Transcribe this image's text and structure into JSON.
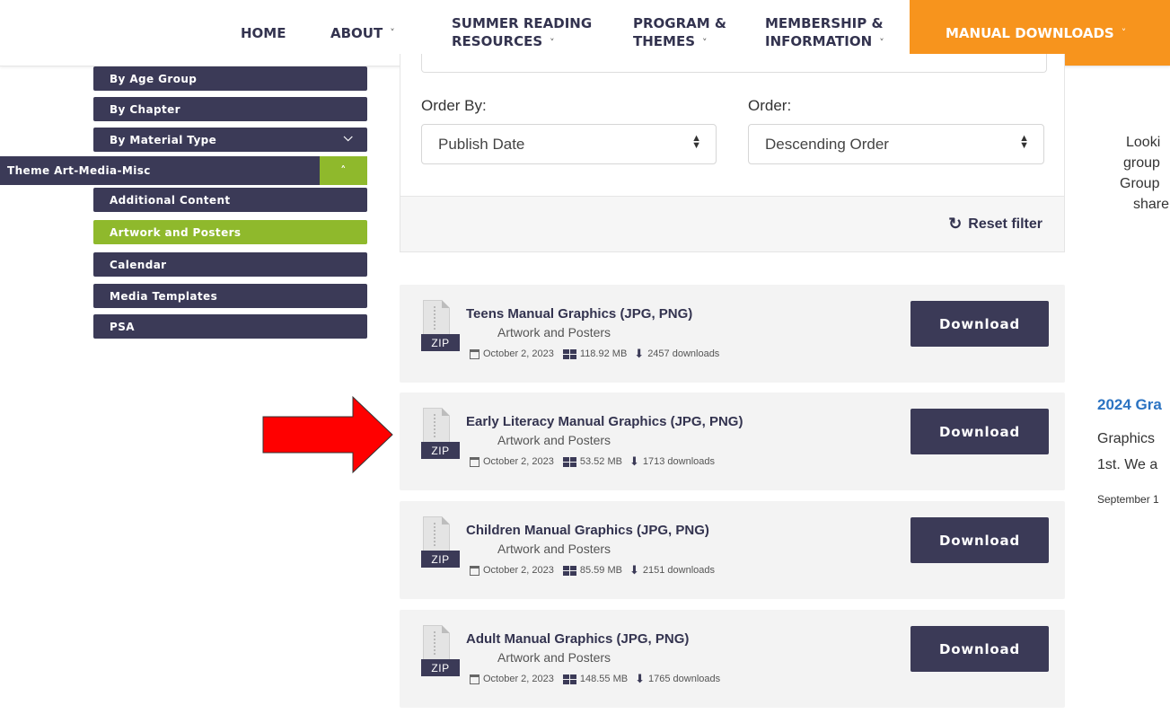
{
  "nav": {
    "items": [
      {
        "line1": "HOME",
        "line2": "",
        "chevron": false
      },
      {
        "line1": "ABOUT",
        "line2": "",
        "chevron": true
      },
      {
        "line1": "SUMMER READING",
        "line2": "RESOURCES",
        "chevron": true
      },
      {
        "line1": "PROGRAM &",
        "line2": "THEMES",
        "chevron": true
      },
      {
        "line1": "MEMBERSHIP &",
        "line2": "INFORMATION",
        "chevron": true
      }
    ],
    "active_label": "MANUAL DOWNLOADS",
    "chevron_glyph": "˅",
    "accent_color": "#f7941d"
  },
  "sidebar": {
    "top_items": [
      "By Age Group",
      "By Chapter",
      "By Material Type"
    ],
    "parent": "Theme Art-Media-Misc",
    "sub_items": [
      "Additional Content",
      "Artwork and Posters",
      "Calendar",
      "Media Templates",
      "PSA"
    ],
    "active_item": "Artwork and Posters",
    "colors": {
      "dark": "#3b3a57",
      "active": "#8fb92c"
    }
  },
  "filter": {
    "order_by_label": "Order By:",
    "order_by_value": "Publish Date",
    "order_label": "Order:",
    "order_value": "Descending Order",
    "reset_label": "Reset filter"
  },
  "downloads": [
    {
      "title": "Teens Manual Graphics (JPG, PNG)",
      "category": "Artwork and Posters",
      "date": "October 2, 2023",
      "size": "118.92 MB",
      "downloads": "2457 downloads",
      "badge": "ZIP",
      "button": "Download"
    },
    {
      "title": "Early Literacy Manual Graphics (JPG, PNG)",
      "category": "Artwork and Posters",
      "date": "October 2, 2023",
      "size": "53.52 MB",
      "downloads": "1713 downloads",
      "badge": "ZIP",
      "button": "Download"
    },
    {
      "title": "Children Manual Graphics (JPG, PNG)",
      "category": "Artwork and Posters",
      "date": "October 2, 2023",
      "size": "85.59 MB",
      "downloads": "2151 downloads",
      "badge": "ZIP",
      "button": "Download"
    },
    {
      "title": "Adult Manual Graphics (JPG, PNG)",
      "category": "Artwork and Posters",
      "date": "October 2, 2023",
      "size": "148.55 MB",
      "downloads": "1765 downloads",
      "badge": "ZIP",
      "button": "Download"
    }
  ],
  "right_column": {
    "lines": [
      "Looki",
      "group",
      "Group",
      "share"
    ],
    "link": "2024 Gra",
    "body": [
      "Graphics",
      "1st. We a"
    ],
    "date": "September 1"
  },
  "annotation": {
    "arrow_color": "#ff0000"
  }
}
